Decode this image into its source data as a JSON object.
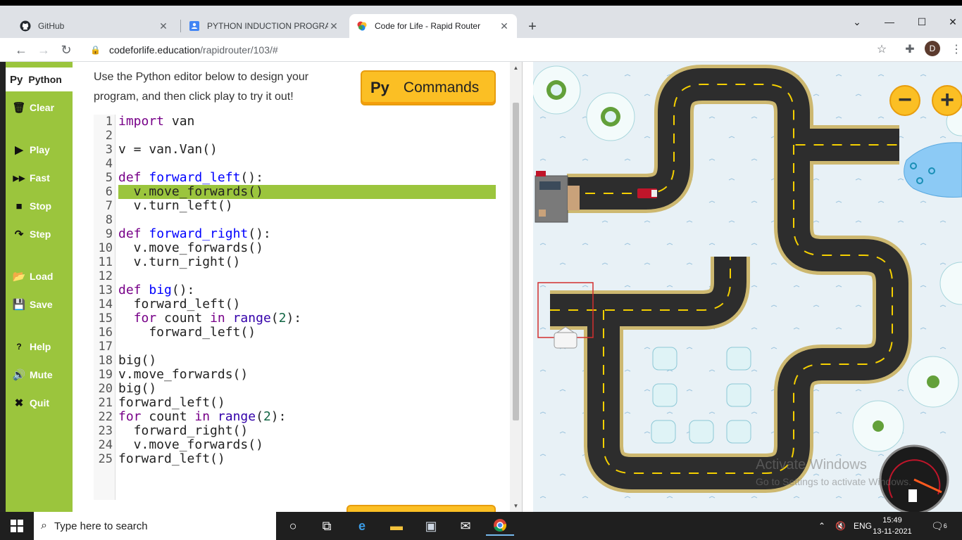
{
  "browser": {
    "tabs": [
      {
        "title": "GitHub",
        "icon": "github-icon"
      },
      {
        "title": "PYTHON INDUCTION PROGRAM",
        "icon": "doc-icon"
      },
      {
        "title": "Code for Life - Rapid Router",
        "icon": "code-for-life-icon"
      }
    ],
    "new_tab": "+",
    "url_host": "codeforlife.education",
    "url_path": "/rapidrouter/103/#",
    "profile_initial": "D"
  },
  "sidebar": {
    "tab_prefix": "Py",
    "tab_label": "Python",
    "items": [
      {
        "label": "Clear",
        "icon": "trash-icon"
      },
      {
        "label": "Play",
        "icon": "play-icon"
      },
      {
        "label": "Fast",
        "icon": "fast-forward-icon"
      },
      {
        "label": "Stop",
        "icon": "stop-icon"
      },
      {
        "label": "Step",
        "icon": "step-icon"
      },
      {
        "label": "Load",
        "icon": "folder-icon"
      },
      {
        "label": "Save",
        "icon": "save-icon"
      },
      {
        "label": "Help",
        "icon": "help-icon"
      },
      {
        "label": "Mute",
        "icon": "speaker-icon"
      },
      {
        "label": "Quit",
        "icon": "close-icon"
      }
    ]
  },
  "instructions": "Use the Python editor below to design your program, and then click play to try it out!",
  "commands_button": {
    "prefix": "Py",
    "label": "Commands"
  },
  "editor": {
    "highlighted_line": 6,
    "lines": [
      "import van",
      "",
      "v = van.Van()",
      "",
      "def forward_left():",
      "  v.move_forwards()",
      "  v.turn_left()",
      "",
      "def forward_right():",
      "  v.move_forwards()",
      "  v.turn_right()",
      "",
      "def big():",
      "  forward_left()",
      "  for count in range(2):",
      "    forward_left()",
      "",
      "big()",
      "v.move_forwards()",
      "big()",
      "forward_left()",
      "for count in range(2):",
      "  forward_right()",
      "  v.move_forwards()",
      "forward_left()"
    ]
  },
  "map": {
    "zoom_out": "−",
    "zoom_in": "+",
    "watermark_title": "Activate Windows",
    "watermark_sub": "Go to Settings to activate Windows."
  },
  "taskbar": {
    "search_placeholder": "Type here to search",
    "language": "ENG",
    "time": "15:49",
    "date": "13-11-2021",
    "notifications": "6"
  },
  "colors": {
    "sidebar_green": "#9bc53d",
    "highlight_green": "#9bc53d",
    "commands_yellow": "#fbbf24"
  }
}
